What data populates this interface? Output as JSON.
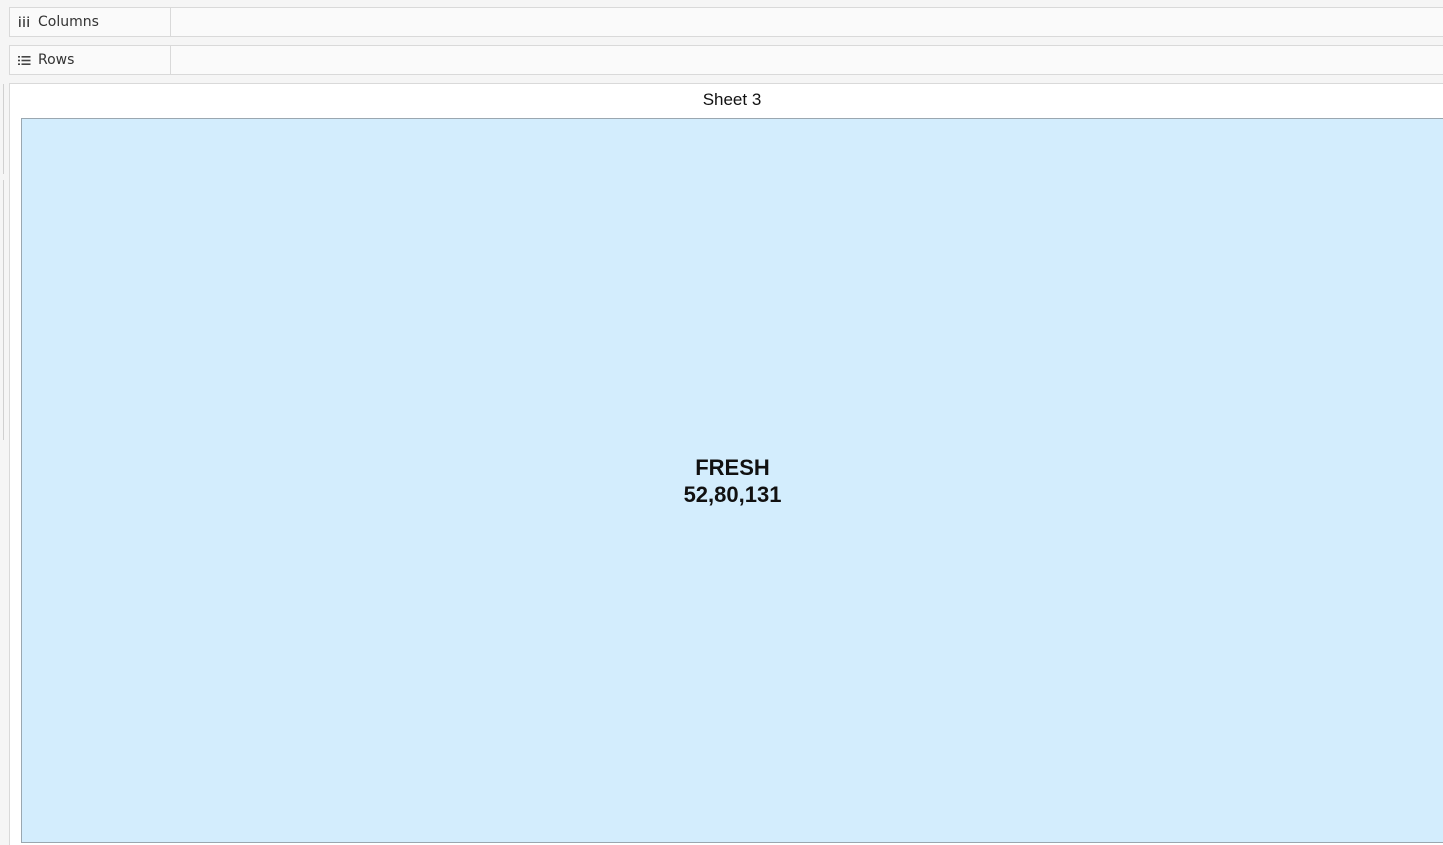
{
  "shelves": {
    "columns": {
      "label": "Columns",
      "icon": "columns-icon",
      "pills": []
    },
    "rows": {
      "label": "Rows",
      "icon": "rows-icon",
      "pills": []
    }
  },
  "view": {
    "title": "Sheet 3",
    "mark": {
      "label_line1": "FRESH",
      "label_line2": "52,80,131",
      "color": "#d3edfd"
    }
  },
  "chart_data": {
    "type": "treemap",
    "title": "Sheet 3",
    "categories": [
      "FRESH"
    ],
    "values": [
      5280131
    ],
    "value_labels": [
      "52,80,131"
    ],
    "colors": [
      "#d3edfd"
    ]
  }
}
